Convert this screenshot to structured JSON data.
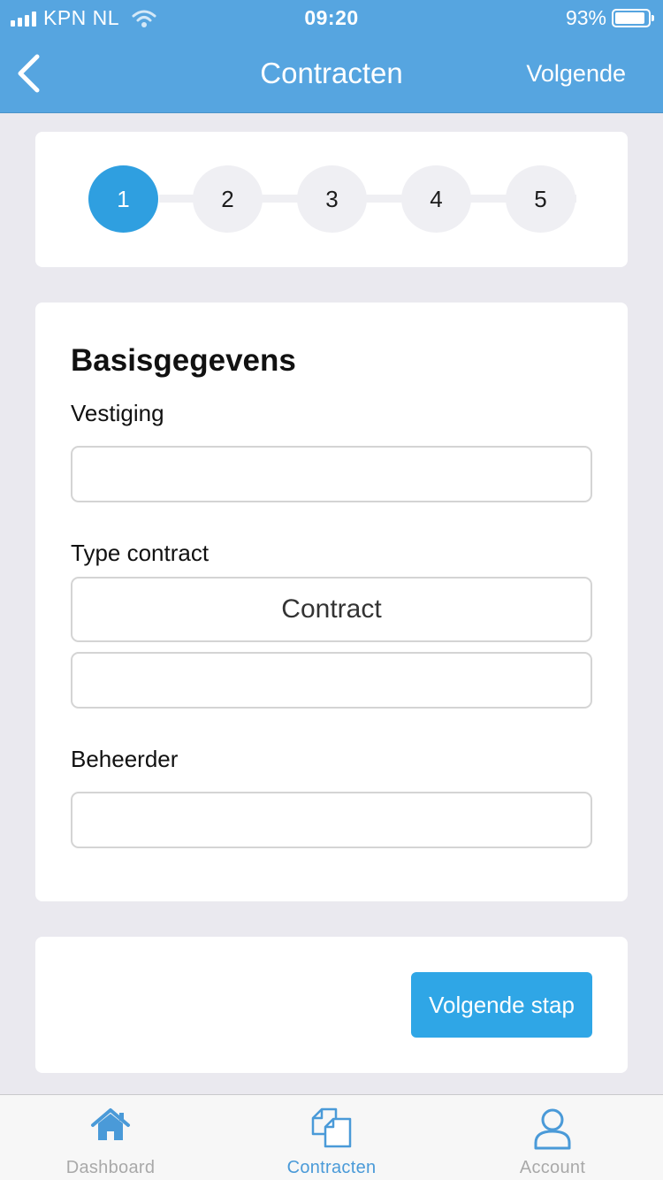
{
  "status_bar": {
    "carrier": "KPN NL",
    "time": "09:20",
    "battery": "93%",
    "battery_level": 0.93
  },
  "nav": {
    "title": "Contracten",
    "next_label": "Volgende",
    "back_icon": "chevron-left-icon"
  },
  "stepper": {
    "steps": [
      "1",
      "2",
      "3",
      "4",
      "5"
    ],
    "active_step": "1"
  },
  "form": {
    "title": "Basisgegevens",
    "vestiging_label": "Vestiging",
    "vestiging_value": "",
    "type_label": "Type contract",
    "type_select_value": "Contract",
    "type_extra_value": "",
    "beheerder_label": "Beheerder",
    "beheerder_value": ""
  },
  "actions": {
    "next_step_label": "Volgende stap"
  },
  "tabbar": {
    "items": [
      {
        "label": "Dashboard",
        "icon": "home-icon",
        "active": false
      },
      {
        "label": "Contracten",
        "icon": "documents-icon",
        "active": true
      },
      {
        "label": "Account",
        "icon": "user-icon",
        "active": false
      }
    ]
  },
  "colors": {
    "header_bg": "#56a5e0",
    "accent": "#2f9fe0",
    "tab_active": "#4a9ad8",
    "tab_inactive": "#a9a9a9"
  }
}
